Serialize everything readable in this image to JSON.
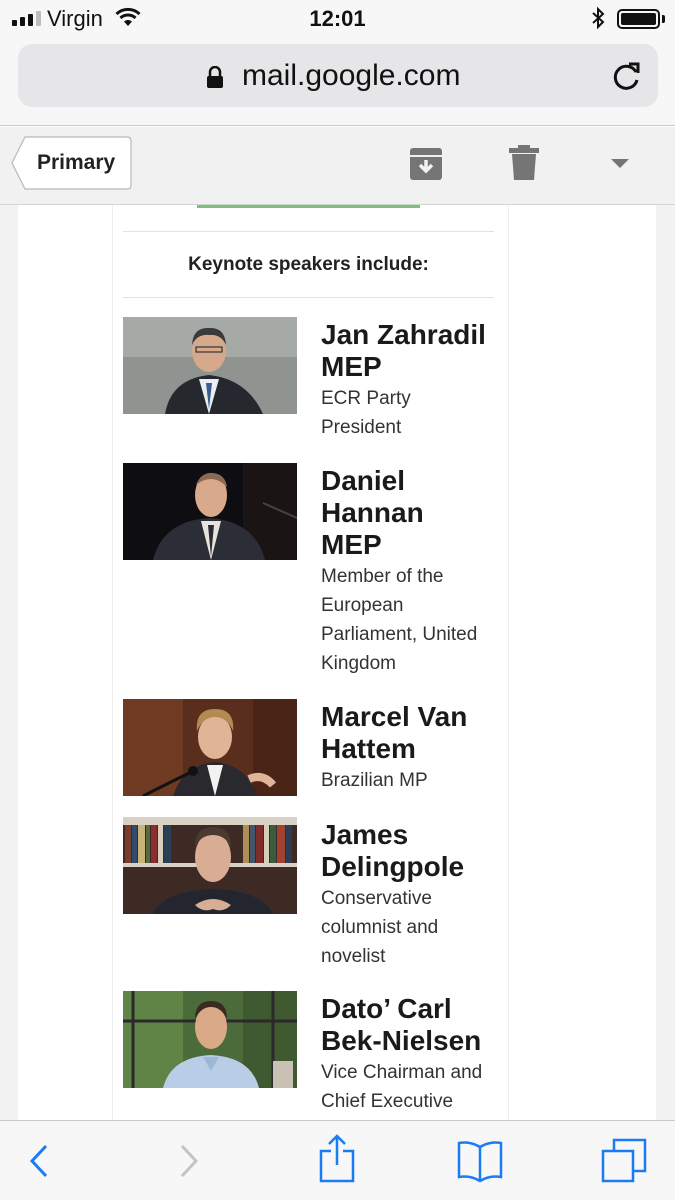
{
  "status_bar": {
    "carrier": "Virgin",
    "time": "12:01",
    "icons": [
      "signal-icon",
      "wifi-icon",
      "bluetooth-icon",
      "battery-icon"
    ]
  },
  "browser": {
    "url": "mail.google.com",
    "icons": [
      "lock-icon",
      "reload-icon"
    ]
  },
  "mail_toolbar": {
    "back_label": "Primary",
    "icons": [
      "archive-icon",
      "trash-icon",
      "more-dropdown-icon"
    ]
  },
  "email": {
    "heading": "Keynote speakers include:",
    "accent_color": "#7ac17a",
    "speakers": [
      {
        "name": "Jan Zahradil MEP",
        "name_lines": [
          "Jan Zahradil",
          "MEP"
        ],
        "role_lines": [
          "ECR Party",
          "President"
        ]
      },
      {
        "name": "Daniel Hannan MEP",
        "name_lines": [
          "Daniel",
          "Hannan",
          "MEP"
        ],
        "role_lines": [
          "Member of the",
          "European",
          "Parliament, United",
          "Kingdom"
        ]
      },
      {
        "name": "Marcel Van Hattem",
        "name_lines": [
          "Marcel Van",
          "Hattem"
        ],
        "role_lines": [
          "Brazilian MP"
        ]
      },
      {
        "name": "James Delingpole",
        "name_lines": [
          "James",
          "Delingpole"
        ],
        "role_lines": [
          "Conservative",
          "columnist and",
          "novelist"
        ]
      },
      {
        "name": "Dato’ Carl Bek-Nielsen",
        "name_lines": [
          "Dato’ Carl",
          "Bek-Nielsen"
        ],
        "role_lines": [
          "Vice Chairman and",
          "Chief Executive"
        ]
      }
    ]
  },
  "bottom_bar": {
    "icons": [
      "back-arrow-icon",
      "forward-arrow-icon",
      "share-icon",
      "bookmarks-icon",
      "tabs-icon"
    ],
    "tint_color": "#1a7cf5"
  }
}
